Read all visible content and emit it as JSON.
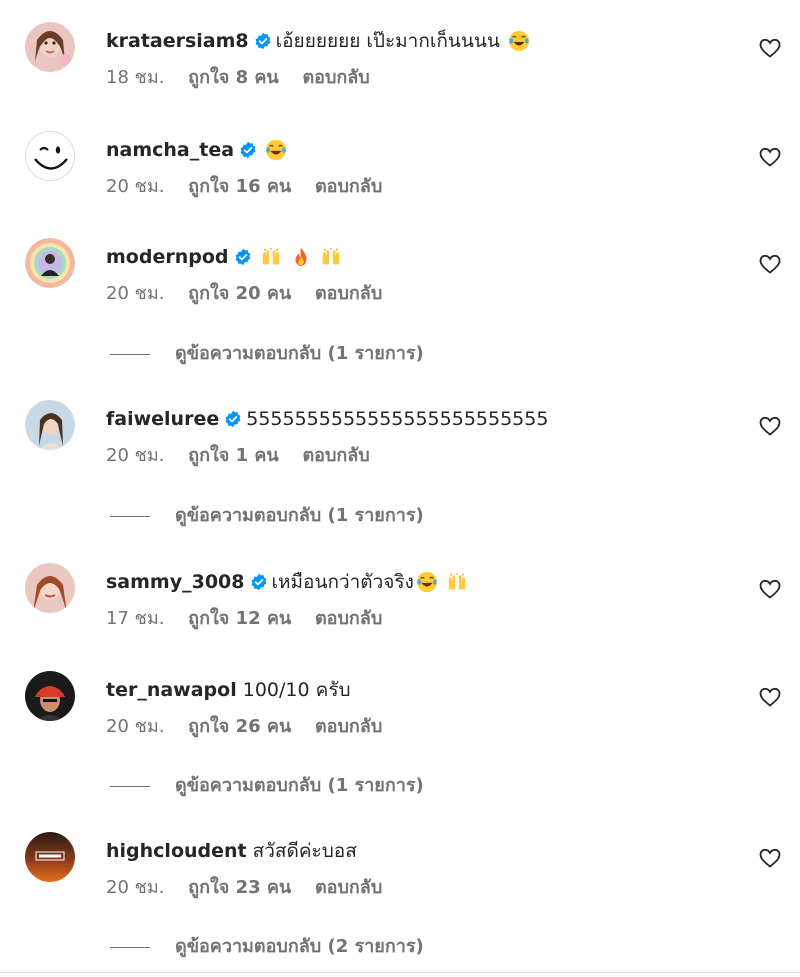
{
  "colors": {
    "text": "#262626",
    "secondary": "#737373",
    "verified": "#0095f6"
  },
  "comments": [
    {
      "username": "krataersiam8",
      "verified": true,
      "text": "เอ้ยยยยยย เป๊ะมากเก็นนนน",
      "emojis": [
        "laughing-tears"
      ],
      "time": "18 ชม.",
      "likes": "ถูกใจ 8 คน",
      "reply": "ตอบกลับ",
      "view_replies": ""
    },
    {
      "username": "namcha_tea",
      "verified": true,
      "text": "",
      "emojis": [
        "laughing-tears"
      ],
      "time": "20 ชม.",
      "likes": "ถูกใจ 16 คน",
      "reply": "ตอบกลับ",
      "view_replies": ""
    },
    {
      "username": "modernpod",
      "verified": true,
      "text": "",
      "emojis": [
        "raised-hands",
        "fire",
        "raised-hands"
      ],
      "time": "20 ชม.",
      "likes": "ถูกใจ 20 คน",
      "reply": "ตอบกลับ",
      "view_replies": "ดูข้อความตอบกลับ (1 รายการ)"
    },
    {
      "username": "faiweluree",
      "verified": true,
      "text": "5555555555555555555555555",
      "emojis": [],
      "time": "20 ชม.",
      "likes": "ถูกใจ 1 คน",
      "reply": "ตอบกลับ",
      "view_replies": "ดูข้อความตอบกลับ (1 รายการ)"
    },
    {
      "username": "sammy_3008",
      "verified": true,
      "text": "เหมือนกว่าตัวจริง",
      "emojis": [
        "laughing-tears",
        "raised-hands"
      ],
      "time": "17 ชม.",
      "likes": "ถูกใจ 12 คน",
      "reply": "ตอบกลับ",
      "view_replies": ""
    },
    {
      "username": "ter_nawapol",
      "verified": false,
      "text": "100/10 ครับ",
      "emojis": [],
      "time": "20 ชม.",
      "likes": "ถูกใจ 26 คน",
      "reply": "ตอบกลับ",
      "view_replies": "ดูข้อความตอบกลับ (1 รายการ)"
    },
    {
      "username": "highcloudent",
      "verified": false,
      "text": "สวัสดีค่ะบอส",
      "emojis": [],
      "time": "20 ชม.",
      "likes": "ถูกใจ 23 คน",
      "reply": "ตอบกลับ",
      "view_replies": "ดูข้อความตอบกลับ (2 รายการ)"
    }
  ],
  "icons": {
    "like": "heart-outline-icon",
    "verified": "verified-badge-icon"
  }
}
